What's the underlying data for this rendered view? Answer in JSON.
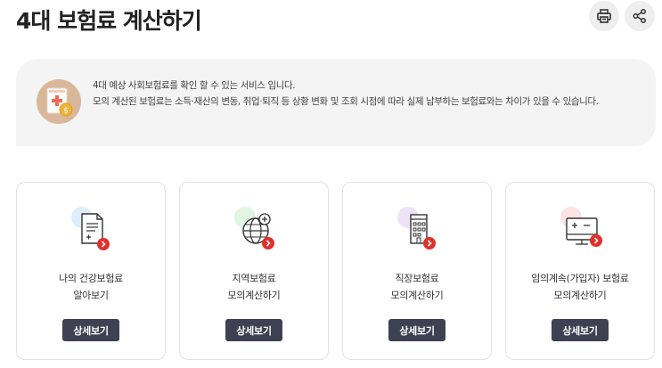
{
  "header": {
    "title": "4대 보험료 계산하기",
    "print_icon": "printer-icon",
    "share_icon": "share-icon"
  },
  "info": {
    "icon": "insurance-document-coin-icon",
    "line1": "4대 예상 사회보험료를 확인 할 수 있는 서비스 입니다.",
    "line2": "모의 계산된 보험료는 소득·재산의 변동, 취업·퇴직 등 상황 변화 및 조회 시점에 따라 실제 납부하는 보험료와는 차이가 있을 수 있습니다."
  },
  "cards": [
    {
      "line1": "나의 건강보험료",
      "line2": "알아보기",
      "button": "상세보기",
      "icon": "document-plus-icon",
      "accent": "#dfeefe"
    },
    {
      "line1": "지역보험료",
      "line2": "모의계산하기",
      "button": "상세보기",
      "icon": "globe-plus-icon",
      "accent": "#e0f5e2"
    },
    {
      "line1": "직장보험료",
      "line2": "모의계산하기",
      "button": "상세보기",
      "icon": "building-icon",
      "accent": "#ece3f7"
    },
    {
      "line1": "임의계속(가입자) 보험료",
      "line2": "모의계산하기",
      "button": "상세보기",
      "icon": "calculator-monitor-icon",
      "accent": "#fde3e3"
    }
  ],
  "colors": {
    "button_bg": "#3d4151",
    "badge_red": "#e0302c",
    "info_bg": "#f4f4f4"
  }
}
